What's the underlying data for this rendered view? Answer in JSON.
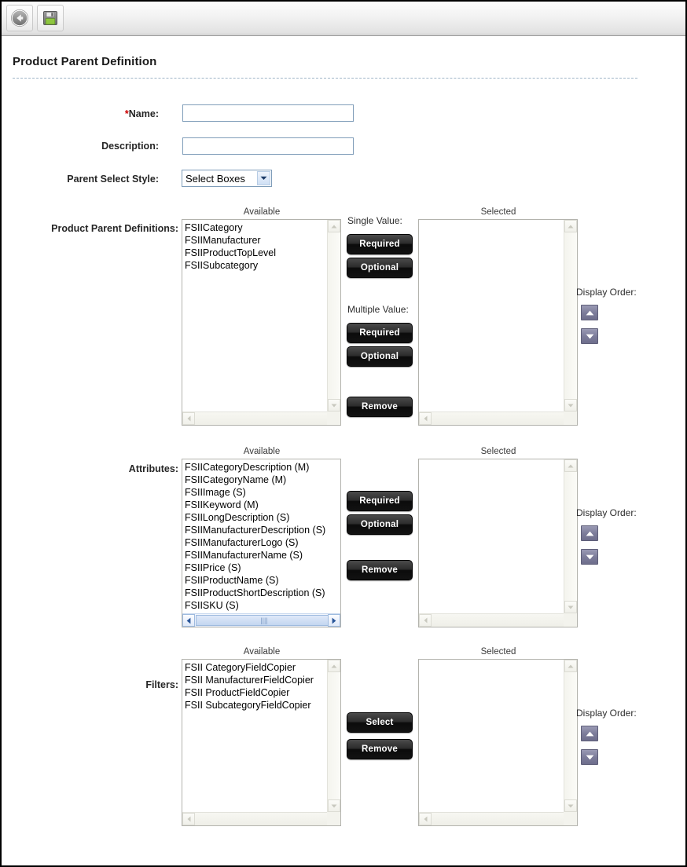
{
  "toolbar": {
    "back_button_label": "Back",
    "save_button_label": "Save"
  },
  "page": {
    "title": "Product Parent Definition"
  },
  "form": {
    "name": {
      "label": "Name:",
      "required_marker": "*",
      "value": "",
      "placeholder": ""
    },
    "description": {
      "label": "Description:",
      "value": "",
      "placeholder": ""
    },
    "parent_select_style": {
      "label": "Parent Select Style:",
      "value": "Select Boxes",
      "options": [
        "Select Boxes"
      ]
    }
  },
  "captions": {
    "available": "Available",
    "selected": "Selected",
    "display_order": "Display Order:"
  },
  "sections": {
    "product_parent_definitions": {
      "label": "Product Parent Definitions:",
      "available_items": [
        "FSIICategory",
        "FSIIManufacturer",
        "FSIIProductTopLevel",
        "FSIISubcategory"
      ],
      "selected_items": [],
      "single_value_caption": "Single Value:",
      "multiple_value_caption": "Multiple Value:",
      "buttons": {
        "single_required": "Required",
        "single_optional": "Optional",
        "multiple_required": "Required",
        "multiple_optional": "Optional",
        "remove": "Remove"
      }
    },
    "attributes": {
      "label": "Attributes:",
      "available_items": [
        "FSIICategoryDescription (M)",
        "FSIICategoryName (M)",
        "FSIIImage (S)",
        "FSIIKeyword (M)",
        "FSIILongDescription (S)",
        "FSIIManufacturerDescription (S)",
        "FSIIManufacturerLogo (S)",
        "FSIIManufacturerName (S)",
        "FSIIPrice (S)",
        "FSIIProductName (S)",
        "FSIIProductShortDescription (S)",
        "FSIISKU (S)"
      ],
      "selected_items": [],
      "buttons": {
        "required": "Required",
        "optional": "Optional",
        "remove": "Remove"
      }
    },
    "filters": {
      "label": "Filters:",
      "available_items": [
        "FSII CategoryFieldCopier",
        "FSII ManufacturerFieldCopier",
        "FSII ProductFieldCopier",
        "FSII SubcategoryFieldCopier"
      ],
      "selected_items": [],
      "buttons": {
        "select": "Select",
        "remove": "Remove"
      }
    }
  },
  "colors": {
    "required_star": "#cc0000",
    "button_bg": "#121212",
    "input_border": "#7f9db9",
    "order_button": "#7d7d9b",
    "title_rule": "#9fb4c7"
  },
  "icons": {
    "back": "back-arrow-icon",
    "save": "floppy-disk-save-icon",
    "scroll_up": "scroll-up-arrow-icon",
    "scroll_down": "scroll-down-arrow-icon",
    "scroll_left": "scroll-left-arrow-icon",
    "scroll_right": "scroll-right-arrow-icon",
    "order_up": "move-up-arrow-icon",
    "order_down": "move-down-arrow-icon",
    "select_chevron": "chevron-down-icon"
  }
}
